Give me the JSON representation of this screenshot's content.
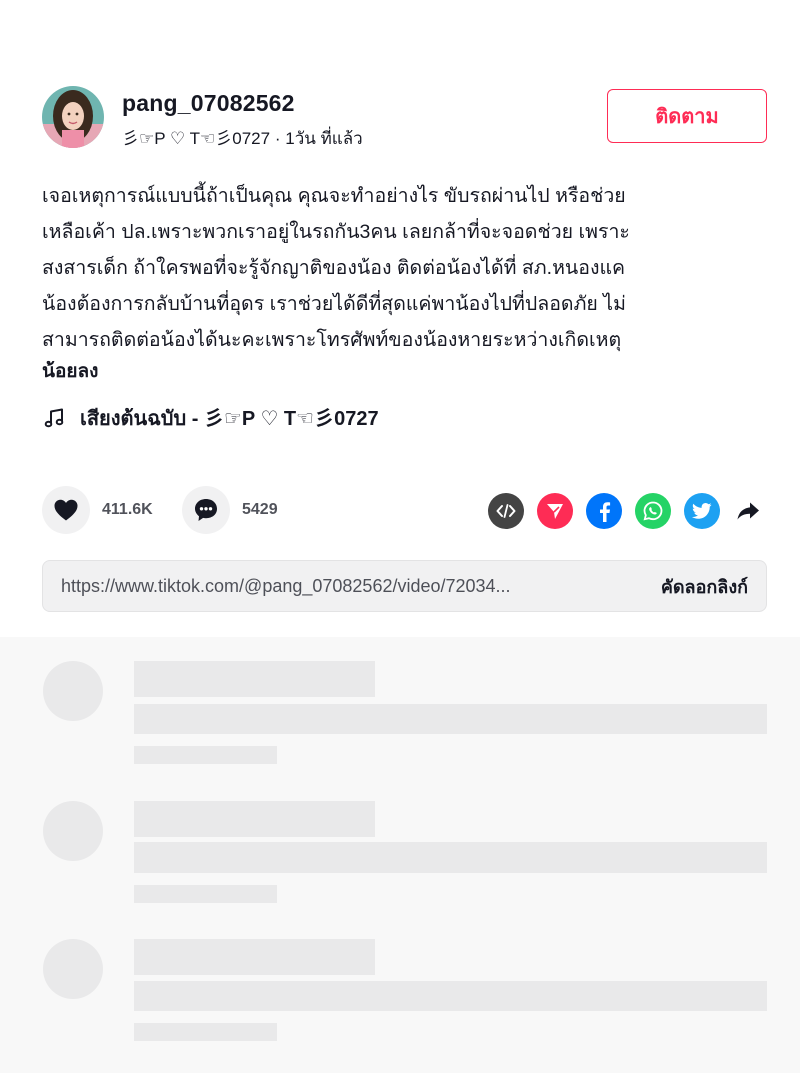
{
  "post": {
    "username": "pang_07082562",
    "nickname": "彡☞P ♡ T☜彡0727",
    "time_ago": "1วัน ที่แล้ว",
    "follow_label": "ติดตาม",
    "caption_lines": [
      "เจอเหตุการณ์แบบนี้ถ้าเป็นคุณ คุณจะทำอย่างไร ขับรถผ่านไป หรือช่วย",
      "เหลือเค้า ปล.เพราะพวกเราอยู่ในรถกัน3คน เลยกล้าที่จะจอดช่วย เพราะ",
      "สงสารเด็ก ถ้าใครพอที่จะรู้จักญาติของน้อง ติดต่อน้องได้ที่ สภ.หนองแค",
      "น้องต้องการกลับบ้านที่อุดร เราช่วยได้ดีที่สุดแค่พาน้องไปที่ปลอดภัย ไม่",
      "สามารถติดต่อน้องได้นะคะเพราะโทรศัพท์ของน้องหายระหว่างเกิดเหตุ"
    ],
    "less_label": "น้อยลง",
    "music": "เสียงต้นฉบับ - 彡☞P ♡ T☜彡0727"
  },
  "actions": {
    "likes": "411.6K",
    "comments": "5429"
  },
  "share": {
    "icons": [
      "embed-icon",
      "send-icon",
      "facebook-icon",
      "whatsapp-icon",
      "twitter-icon",
      "share-arrow-icon"
    ],
    "colors": {
      "embed": "#444444",
      "send": "#fe2c55",
      "facebook": "#0075fa",
      "whatsapp": "#25d366",
      "twitter": "#1da1f2"
    }
  },
  "link": {
    "url": "https://www.tiktok.com/@pang_07082562/video/72034...",
    "copy_label": "คัดลอกลิงก์"
  },
  "colors": {
    "accent": "#fe2c55",
    "text": "#161823",
    "skeleton": "#e9e9ea"
  }
}
